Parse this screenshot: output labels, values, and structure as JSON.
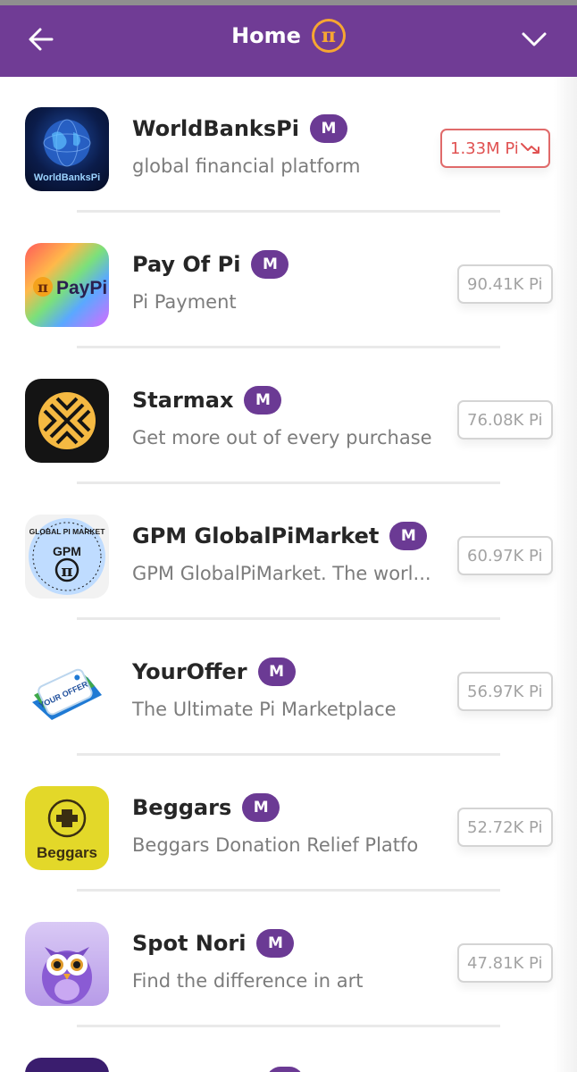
{
  "header": {
    "title": "Home",
    "pi_symbol": "π",
    "back_icon": "arrow-left-icon",
    "chevron_icon": "chevron-down-icon",
    "color": "#703c95"
  },
  "apps": [
    {
      "name": "WorldBanksPi",
      "badge": "M",
      "description": "global financial platform",
      "stake": "1.33M Pi",
      "trend": "down",
      "icon": "globe-icon",
      "icon_label": "WorldBanksPi"
    },
    {
      "name": "Pay Of Pi",
      "badge": "M",
      "description": "Pi Payment",
      "stake": "90.41K Pi",
      "icon": "paypi-icon",
      "icon_label": "PayPi",
      "icon_pi": "π"
    },
    {
      "name": "Starmax",
      "badge": "M",
      "description": "Get more out of every purchase",
      "stake": "76.08K Pi",
      "icon": "starmax-icon"
    },
    {
      "name": "GPM GlobalPiMarket",
      "badge": "M",
      "description": "GPM GlobalPiMarket. The worl...",
      "stake": "60.97K Pi",
      "icon": "gpm-icon",
      "icon_label": "GLOBAL PI MARKET",
      "icon_sub": "GPM",
      "icon_pi": "π"
    },
    {
      "name": "YourOffer",
      "badge": "M",
      "description": "The Ultimate Pi Marketplace",
      "stake": "56.97K Pi",
      "icon": "youroffer-tag-icon",
      "icon_label": "YOUR OFFER"
    },
    {
      "name": "Beggars",
      "badge": "M",
      "description": "Beggars Donation Relief Platfo",
      "stake": "52.72K Pi",
      "icon": "beggars-icon",
      "icon_label": "Beggars"
    },
    {
      "name": "Spot Nori",
      "badge": "M",
      "description": "Find the difference in art",
      "stake": "47.81K Pi",
      "icon": "owl-icon"
    }
  ]
}
